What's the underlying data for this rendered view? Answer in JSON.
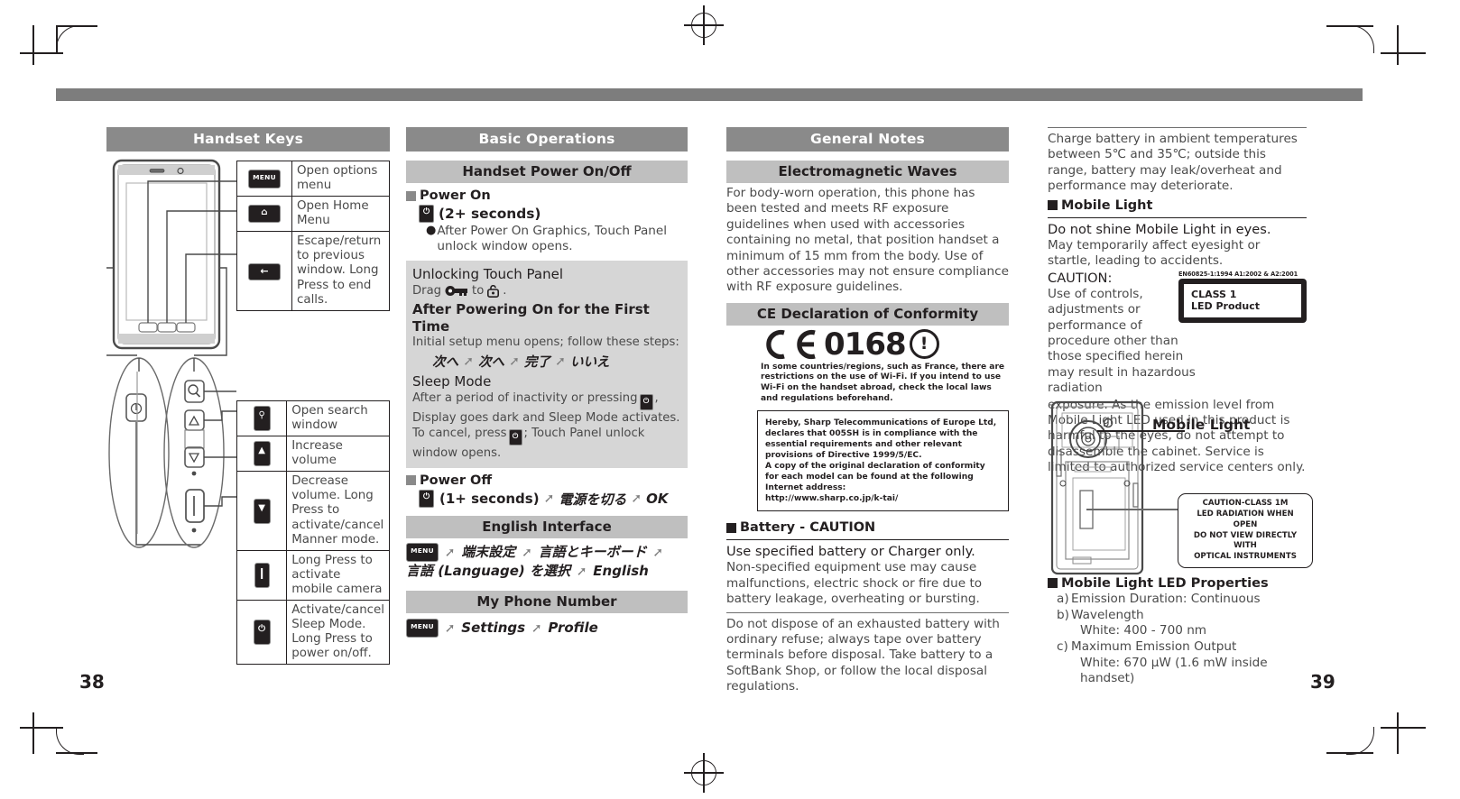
{
  "document": {
    "page_left": "38",
    "page_right": "39"
  },
  "col1": {
    "title": "Handset Keys",
    "keys_top": [
      {
        "icon": "menu-key-icon",
        "glyph": "MENU",
        "desc": "Open options menu"
      },
      {
        "icon": "home-key-icon",
        "glyph": "⌂",
        "desc": "Open Home Menu"
      },
      {
        "icon": "back-key-icon",
        "glyph": "←",
        "desc": "Escape/return to previous window. Long Press to end calls."
      }
    ],
    "keys_bottom": [
      {
        "icon": "search-key-icon",
        "glyph": "⚲",
        "desc": "Open search window"
      },
      {
        "icon": "volume-up-key-icon",
        "glyph": "▲",
        "desc": "Increase volume"
      },
      {
        "icon": "volume-down-key-icon",
        "glyph": "▼",
        "desc": "Decrease volume. Long Press to activate/cancel Manner mode."
      },
      {
        "icon": "camera-key-icon",
        "glyph": "❙",
        "desc": "Long Press to activate mobile camera"
      },
      {
        "icon": "power-key-icon",
        "glyph": "⏻",
        "desc": "Activate/cancel Sleep Mode. Long Press to power on/off."
      }
    ]
  },
  "col2": {
    "title": "Basic Operations",
    "power_section": {
      "title": "Handset Power On/Off",
      "power_on_head": "Power On",
      "power_on_key": "⏻",
      "power_on_duration": "(2+ seconds)",
      "power_on_bullet": "After Power On Graphics, Touch Panel unlock window opens.",
      "box": {
        "unlock_head": "Unlocking Touch Panel",
        "unlock_line_pre": "Drag",
        "unlock_line_mid": "to",
        "unlock_line_post": ".",
        "first_time_head": "After Powering On for the First Time",
        "first_time_text": "Initial setup menu opens; follow these steps:",
        "first_time_steps": [
          "次へ",
          "次へ",
          "完了",
          "いいえ"
        ],
        "sleep_head": "Sleep Mode",
        "sleep_text_a": "After a period of inactivity or pressing",
        "sleep_text_b": ", Display goes dark and Sleep Mode activates. To cancel, press",
        "sleep_text_c": "; Touch Panel unlock window opens."
      },
      "power_off_head": "Power Off",
      "power_off_key": "⏻",
      "power_off_duration": "(1+ seconds)",
      "power_off_steps": [
        "電源を切る",
        "OK"
      ]
    },
    "english_section": {
      "title": "English Interface",
      "menu_label": "MENU",
      "steps": [
        "端末設定",
        "言語とキーボード",
        "言語 (Language) を選択",
        "English"
      ]
    },
    "phone_section": {
      "title": "My Phone Number",
      "menu_label": "MENU",
      "steps": [
        "Settings",
        "Profile"
      ]
    }
  },
  "col3": {
    "title": "General Notes",
    "emw": {
      "title": "Electromagnetic Waves",
      "text": "For body-worn operation, this phone has been tested and meets RF exposure guidelines when used with accessories containing no metal, that position handset a minimum of 15 mm from the body. Use of other accessories may not ensure compliance with RF exposure guidelines."
    },
    "ce": {
      "title": "CE Declaration of Conformity",
      "mark": "ƆƐ 0168",
      "mark_text": "0168",
      "note": "In some countries/regions, such as France, there are restrictions on the use of Wi-Fi. If you intend to use Wi-Fi on the handset abroad, check the local laws and regulations beforehand.",
      "declaration": "Hereby, Sharp Telecommunications of Europe Ltd, declares that 005SH is in compliance with the essential requirements and other relevant provisions of Directive 1999/5/EC.\nA copy of the original declaration of conformity for each model can be found at the following Internet address:\nhttp://www.sharp.co.jp/k-tai/"
    },
    "battery": {
      "head": "Battery - CAUTION",
      "lead": "Use specified battery or Charger only.",
      "body": "Non-specified equipment use may cause malfunctions, electric shock or fire due to battery leakage, overheating or bursting.",
      "body2": "Do not dispose of an exhausted battery with ordinary refuse; always tape over battery terminals before disposal. Take battery to a SoftBank Shop, or follow the local disposal regulations."
    }
  },
  "col4": {
    "charge_text": "Charge battery in ambient temperatures between 5℃ and 35℃; outside this range, battery may leak/overheat and performance may deteriorate.",
    "mobile_light_head": "Mobile Light",
    "no_shine_lead": "Do not shine Mobile Light in eyes.",
    "no_shine_body": "May temporarily affect eyesight or startle, leading to accidents.",
    "caution_word": "CAUTION:",
    "caution_body_narrow": "Use of controls, adjustments or performance of procedure other than those specified herein may result in hazardous radiation",
    "caution_body_wide": "exposure. As the emission level from Mobile Light LED used in this product is harmful to the eyes, do not attempt to disassemble the cabinet. Service is limited to authorized service centers only.",
    "led_label": {
      "standard": "EN60825-1:1994  A1:2002 & A2:2001",
      "line1": "CLASS 1",
      "line2": "LED Product"
    },
    "diagram": {
      "callout": "Mobile Light",
      "balloon": "CAUTION-CLASS 1M\nLED RADIATION WHEN OPEN\nDO NOT VIEW DIRECTLY WITH\nOPTICAL INSTRUMENTS"
    },
    "led_props": {
      "head": "Mobile Light LED Properties",
      "items": [
        {
          "mark": "a)",
          "text": "Emission Duration: Continuous"
        },
        {
          "mark": "b)",
          "text": "Wavelength"
        },
        {
          "mark": "",
          "text": "White: 400 - 700 nm",
          "sub": true
        },
        {
          "mark": "c)",
          "text": "Maximum Emission Output"
        },
        {
          "mark": "",
          "text": "White: 670 μW (1.6 mW inside handset)",
          "sub": true
        }
      ]
    }
  },
  "colors": {
    "header_dark": "#8a8a8a",
    "header_light": "#bfbfbf",
    "band": "#7d7d7d",
    "ink": "#231f20",
    "body": "#4a4a4a",
    "box_grey": "#d6d6d6"
  }
}
